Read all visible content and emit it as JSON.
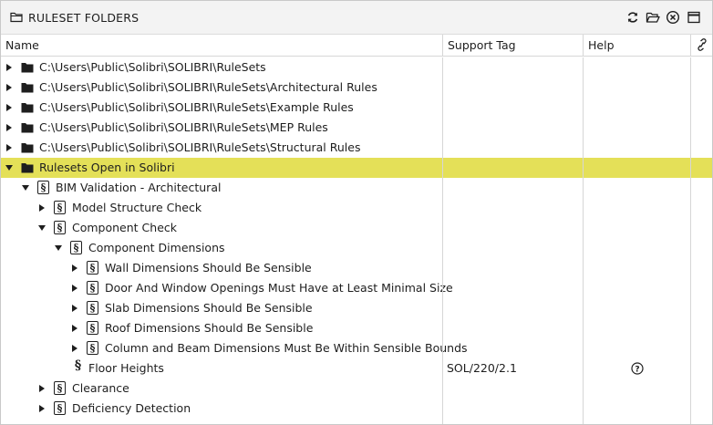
{
  "panel": {
    "title": "RULESET FOLDERS",
    "toolbar_icons": [
      "refresh-icon",
      "open-folder-icon",
      "close-circle-icon",
      "maximize-icon"
    ]
  },
  "columns": {
    "name": "Name",
    "support_tag": "Support Tag",
    "help": "Help",
    "link_icon": "link-icon"
  },
  "rows": [
    {
      "label": "C:\\Users\\Public\\Solibri\\SOLIBRI\\RuleSets",
      "type": "folder",
      "expander": "collapsed"
    },
    {
      "label": "C:\\Users\\Public\\Solibri\\SOLIBRI\\RuleSets\\Architectural Rules",
      "type": "folder",
      "expander": "collapsed"
    },
    {
      "label": "C:\\Users\\Public\\Solibri\\SOLIBRI\\RuleSets\\Example Rules",
      "type": "folder",
      "expander": "collapsed"
    },
    {
      "label": "C:\\Users\\Public\\Solibri\\SOLIBRI\\RuleSets\\MEP Rules",
      "type": "folder",
      "expander": "collapsed"
    },
    {
      "label": "C:\\Users\\Public\\Solibri\\SOLIBRI\\RuleSets\\Structural Rules",
      "type": "folder",
      "expander": "collapsed"
    },
    {
      "label": "Rulesets Open in Solibri",
      "type": "folder",
      "expander": "expanded",
      "selected": true
    },
    {
      "label": "BIM Validation - Architectural",
      "type": "ruleset",
      "expander": "expanded"
    },
    {
      "label": "Model Structure Check",
      "type": "ruleset",
      "expander": "collapsed"
    },
    {
      "label": "Component Check",
      "type": "ruleset",
      "expander": "expanded"
    },
    {
      "label": "Component Dimensions",
      "type": "ruleset",
      "expander": "expanded"
    },
    {
      "label": "Wall Dimensions Should Be Sensible",
      "type": "ruleset",
      "expander": "collapsed"
    },
    {
      "label": "Door And Window Openings Must Have at Least Minimal Size",
      "type": "ruleset",
      "expander": "collapsed"
    },
    {
      "label": "Slab Dimensions Should Be Sensible",
      "type": "ruleset",
      "expander": "collapsed"
    },
    {
      "label": "Roof Dimensions Should Be Sensible",
      "type": "ruleset",
      "expander": "collapsed"
    },
    {
      "label": "Column and Beam Dimensions Must Be Within Sensible Bounds",
      "type": "ruleset",
      "expander": "collapsed"
    },
    {
      "label": "Floor Heights",
      "type": "rule",
      "expander": "none",
      "support_tag": "SOL/220/2.1",
      "help_icon": "help-icon"
    },
    {
      "label": "Clearance",
      "type": "ruleset",
      "expander": "collapsed"
    },
    {
      "label": "Deficiency Detection",
      "type": "ruleset",
      "expander": "collapsed"
    }
  ],
  "colors": {
    "selection": "#e4e058",
    "folder": "#1e1e1e",
    "grid": "#d6d6d6"
  }
}
